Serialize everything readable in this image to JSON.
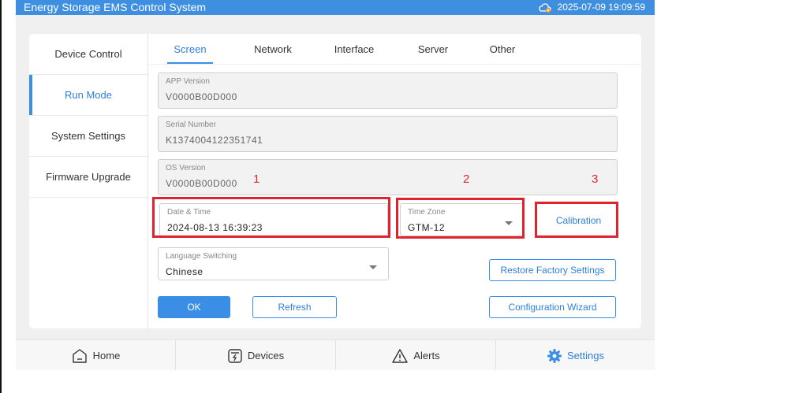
{
  "header": {
    "title": "Energy Storage EMS Control System",
    "datetime": "2025-07-09 19:09:59",
    "cloud_icon": "cloud-offline-icon"
  },
  "sidebar": {
    "items": [
      {
        "label": "Device Control"
      },
      {
        "label": "Run Mode"
      },
      {
        "label": "System Settings"
      },
      {
        "label": "Firmware Upgrade"
      }
    ]
  },
  "tabs": [
    {
      "label": "Screen"
    },
    {
      "label": "Network"
    },
    {
      "label": "Interface"
    },
    {
      "label": "Server"
    },
    {
      "label": "Other"
    }
  ],
  "fields": {
    "app_version": {
      "label": "APP Version",
      "value": "V0000B00D000"
    },
    "serial_number": {
      "label": "Serial Number",
      "value": "K1374004122351741"
    },
    "os_version": {
      "label": "OS Version",
      "value": "V0000B00D000"
    },
    "date_time": {
      "label": "Date & Time",
      "value": "2024-08-13 16:39:23"
    },
    "time_zone": {
      "label": "Time Zone",
      "value": "GTM-12"
    },
    "language": {
      "label": "Language Switching",
      "value": "Chinese"
    }
  },
  "annotations": {
    "one": "1",
    "two": "2",
    "three": "3"
  },
  "buttons": {
    "calibration": "Calibration",
    "restore_factory": "Restore Factory Settings",
    "ok": "OK",
    "refresh": "Refresh",
    "config_wizard": "Configuration Wizard"
  },
  "bottom_nav": [
    {
      "label": "Home",
      "icon": "home-icon"
    },
    {
      "label": "Devices",
      "icon": "devices-icon"
    },
    {
      "label": "Alerts",
      "icon": "alert-icon"
    },
    {
      "label": "Settings",
      "icon": "gear-icon"
    }
  ],
  "colors": {
    "accent": "#3a8ee6",
    "annotation_red": "#e0242e"
  }
}
